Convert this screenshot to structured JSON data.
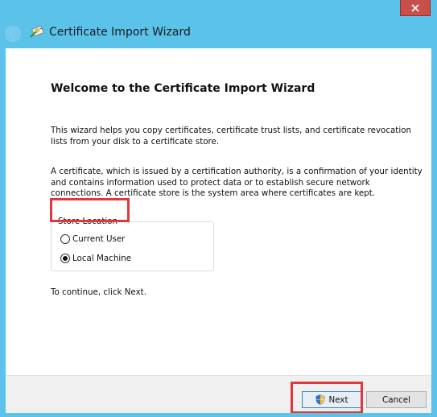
{
  "window": {
    "title": "Certificate Import Wizard",
    "close_icon": "close-icon",
    "back_icon": "back-arrow-icon",
    "app_icon": "certificate-wizard-icon"
  },
  "main": {
    "heading": "Welcome to the Certificate Import Wizard",
    "paragraph1": "This wizard helps you copy certificates, certificate trust lists, and certificate revocation lists from your disk to a certificate store.",
    "paragraph2": "A certificate, which is issued by a certification authority, is a confirmation of your identity and contains information used to protect data or to establish secure network connections. A certificate store is the system area where certificates are kept.",
    "store_location": {
      "label": "Store Location",
      "options": [
        {
          "label": "Current User",
          "selected": false
        },
        {
          "label": "Local Machine",
          "selected": true
        }
      ]
    },
    "continue_text": "To continue, click Next."
  },
  "footer": {
    "next_label": "Next",
    "cancel_label": "Cancel",
    "next_icon": "uac-shield-icon"
  },
  "colors": {
    "window_frame": "#5bc3ea",
    "close_button": "#c7504b",
    "highlight": "#e0383c"
  }
}
